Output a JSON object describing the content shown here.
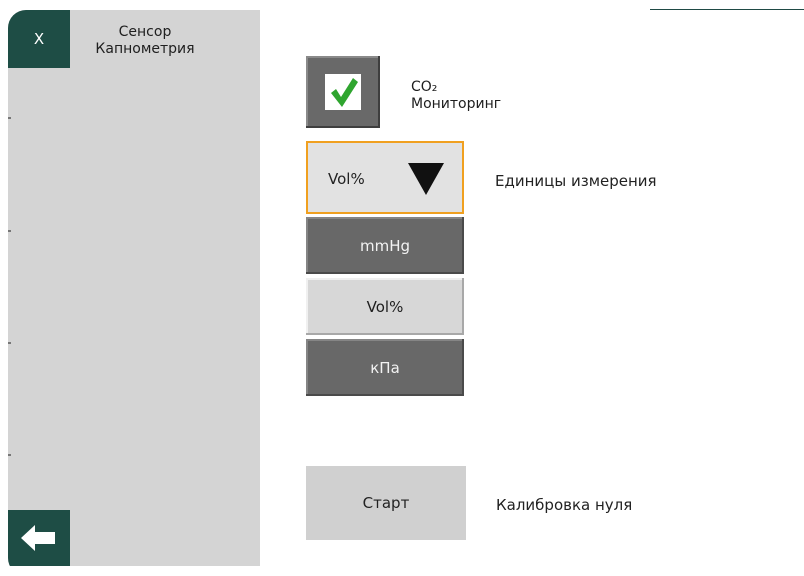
{
  "sidebar": {
    "close_label": "X",
    "title_line1": "Сенсор",
    "title_line2": "Капнометрия",
    "back_icon": "arrow-left-icon"
  },
  "co2": {
    "checked": true,
    "label_line1": "CO₂",
    "label_line2": "Мониторинг",
    "check_icon": "checkmark-icon"
  },
  "units": {
    "selected": "Vol%",
    "label": "Единицы измерения",
    "options": [
      "mmHg",
      "Vol%",
      "кПа"
    ]
  },
  "calibration": {
    "button_label": "Старт",
    "label": "Калибровка нуля"
  },
  "colors": {
    "accent": "#1e4d45",
    "focus_border": "#f0a020",
    "check_green": "#2fa52f"
  }
}
